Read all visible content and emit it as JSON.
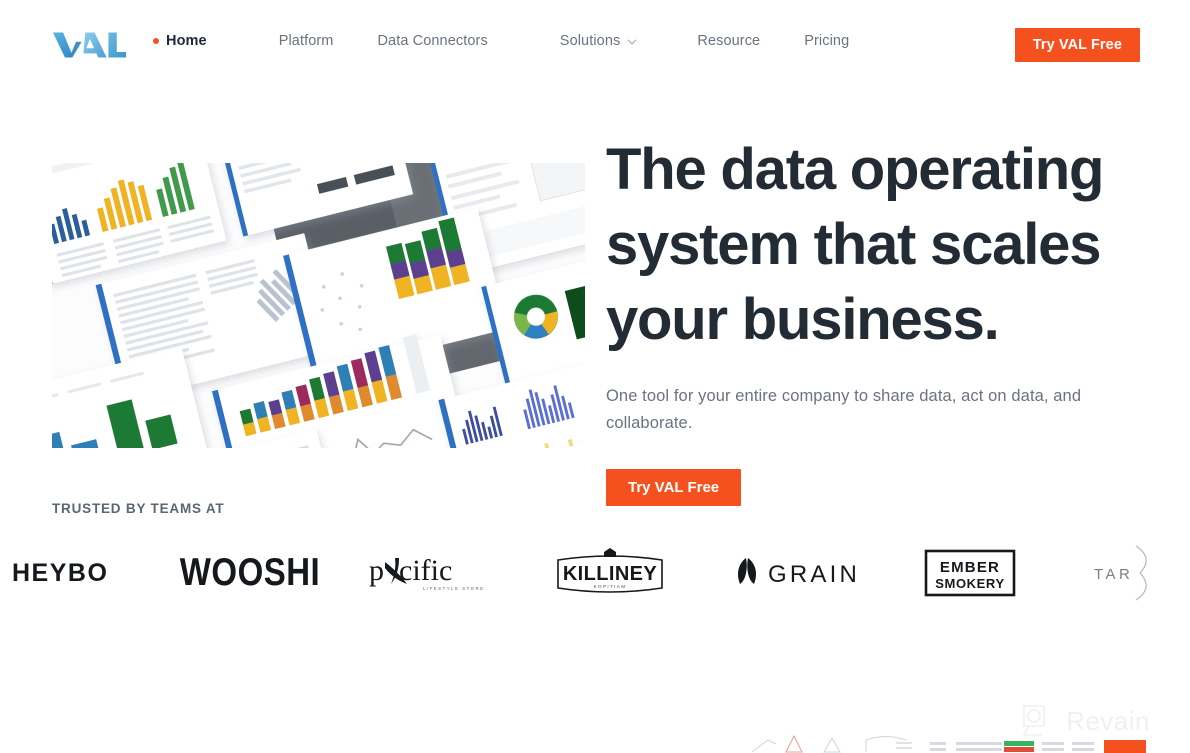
{
  "brand": {
    "name": "VAL",
    "logo_colors": [
      "#4aa3d8",
      "#2f80c2",
      "#7fc3e8"
    ]
  },
  "colors": {
    "accent": "#f4511e",
    "headline": "#232c35",
    "body_text": "#6b7280",
    "nav_active": "#1f2937",
    "page_bg": "#ffffff"
  },
  "header": {
    "nav_items": [
      {
        "label": "Home",
        "active": true,
        "has_dot": true,
        "has_chevron": false
      },
      {
        "label": "Platform",
        "active": false,
        "has_dot": false,
        "has_chevron": false
      },
      {
        "label": "Data Connectors",
        "active": false,
        "has_dot": false,
        "has_chevron": false
      },
      {
        "label": "Solutions",
        "active": false,
        "has_dot": false,
        "has_chevron": true
      },
      {
        "label": "Resource",
        "active": false,
        "has_dot": false,
        "has_chevron": false
      },
      {
        "label": "Pricing",
        "active": false,
        "has_dot": false,
        "has_chevron": false
      }
    ],
    "cta_label": "Try VAL Free"
  },
  "hero": {
    "headline_line1": "The data operating",
    "headline_line2": "system that scales",
    "headline_line3": "your business.",
    "subhead": "One tool for your entire company to share data, act on data, and collaborate.",
    "cta_label": "Try VAL Free",
    "image_alt": "Collage of tilted analytics dashboard screenshots with bar charts, line charts, pie charts and data tables"
  },
  "trusted": {
    "label": "TRUSTED BY TEAMS AT",
    "logos": [
      {
        "name": "HEYBO",
        "display": "HEYBO",
        "style": "bold-sans",
        "clipped": "left"
      },
      {
        "name": "WOOSHI",
        "display": "WOOSHI",
        "style": "condensed-bold"
      },
      {
        "name": "Pacific",
        "display": "pacific",
        "tagline": "LIFESTYLE STORE",
        "style": "serif-mark"
      },
      {
        "name": "KILLINEY",
        "display": "KILLINEY",
        "tagline": "KOPITIAM",
        "style": "badge"
      },
      {
        "name": "GRAIN",
        "display": "GRAIN",
        "style": "leaf-mark"
      },
      {
        "name": "EMBER SMOKERY",
        "display_line1": "EMBER",
        "display_line2": "SMOKERY",
        "style": "boxed"
      },
      {
        "name": "TAR",
        "display": "TAR",
        "style": "arc-mark",
        "clipped": "right"
      }
    ]
  },
  "watermark": {
    "text": "Revain",
    "icon": "magnifier-icon"
  }
}
